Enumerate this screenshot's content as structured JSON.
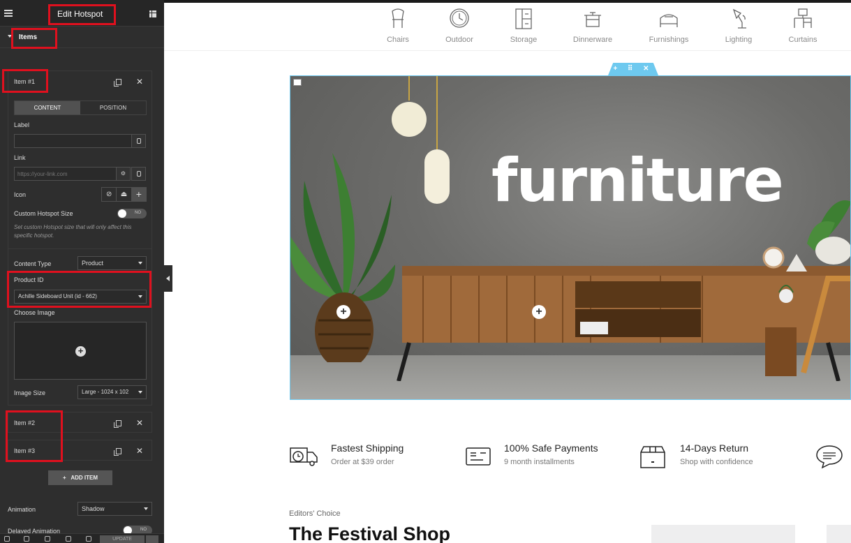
{
  "panel": {
    "title": "Edit Hotspot",
    "section_label": "Items",
    "items": [
      {
        "label": "Item #1"
      },
      {
        "label": "Item #2"
      },
      {
        "label": "Item #3"
      }
    ],
    "tabs": [
      "CONTENT",
      "POSITION"
    ],
    "fields": {
      "label_label": "Label",
      "label_value": "",
      "link_label": "Link",
      "link_placeholder": "https://your-link.com",
      "icon_label": "Icon",
      "custom_size_label": "Custom Hotspot Size",
      "custom_size_toggle": "NO",
      "custom_size_help": "Set custom Hotspot size that will only affect this specific hotspot.",
      "content_type_label": "Content Type",
      "content_type_value": "Product",
      "product_id_label": "Product ID",
      "product_id_value": "Achille Sideboard Unit (id - 662)",
      "choose_image_label": "Choose Image",
      "image_size_label": "Image Size",
      "image_size_value": "Large - 1024 x 102"
    },
    "add_item_label": "ADD ITEM",
    "animation_label": "Animation",
    "animation_value": "Shadow",
    "delayed_animation_label": "Delayed Animation",
    "delayed_animation_toggle": "NO",
    "update_label": "UPDATE"
  },
  "categories": [
    {
      "label": "Chairs",
      "icon": "chair-icon"
    },
    {
      "label": "Outdoor",
      "icon": "clock-icon"
    },
    {
      "label": "Storage",
      "icon": "cabinet-icon"
    },
    {
      "label": "Dinnerware",
      "icon": "pot-icon"
    },
    {
      "label": "Furnishings",
      "icon": "bed-icon"
    },
    {
      "label": "Lighting",
      "icon": "lamp-icon"
    },
    {
      "label": "Curtains",
      "icon": "desk-icon"
    }
  ],
  "hero": {
    "title": "furniture"
  },
  "features": [
    {
      "title": "Fastest Shipping",
      "subtitle": "Order at $39 order",
      "icon": "truck-icon"
    },
    {
      "title": "100% Safe Payments",
      "subtitle": "9 month installments",
      "icon": "card-icon"
    },
    {
      "title": "14-Days Return",
      "subtitle": "Shop with confidence",
      "icon": "box-icon"
    },
    {
      "title": "",
      "subtitle": "",
      "icon": "chat-icon"
    }
  ],
  "section": {
    "eyebrow": "Editors' Choice",
    "title": "The Festival Shop"
  },
  "colors": {
    "panel_bg": "#2e2e2e",
    "highlight": "#e0101e",
    "editor_accent": "#6ec9ef"
  }
}
